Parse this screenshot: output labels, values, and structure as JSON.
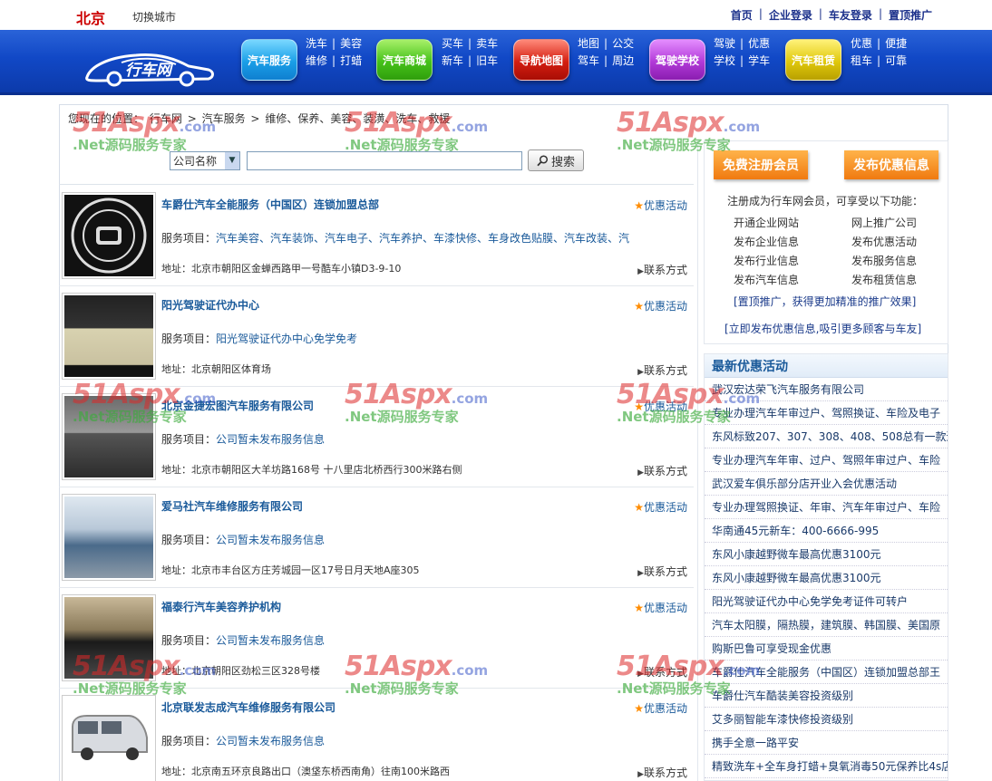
{
  "header": {
    "city": "北京",
    "switch_city": "切换城市",
    "links": [
      "首页",
      "企业登录",
      "车友登录",
      "置顶推广"
    ]
  },
  "nav": {
    "logo_text": "行车网",
    "groups": [
      {
        "button": "汽车服务",
        "links": [
          [
            "洗车",
            "美容"
          ],
          [
            "维修",
            "打蜡"
          ]
        ]
      },
      {
        "button": "汽车商城",
        "links": [
          [
            "买车",
            "卖车"
          ],
          [
            "新车",
            "旧车"
          ]
        ]
      },
      {
        "button": "导航地图",
        "links": [
          [
            "地图",
            "公交"
          ],
          [
            "驾车",
            "周边"
          ]
        ]
      },
      {
        "button": "驾驶学校",
        "links": [
          [
            "驾驶",
            "优惠"
          ],
          [
            "学校",
            "学车"
          ]
        ]
      },
      {
        "button": "汽车租赁",
        "links": [
          [
            "优惠",
            "便捷"
          ],
          [
            "租车",
            "可靠"
          ]
        ]
      }
    ]
  },
  "breadcrumb": {
    "prefix": "您现在的位置：",
    "items": [
      "行车网",
      "汽车服务",
      "维修、保养、美容、装潢、洗车、救援"
    ],
    "sep": ">"
  },
  "search": {
    "select_value": "公司名称",
    "button": "搜索"
  },
  "listing_labels": {
    "service": "服务项目：",
    "address": "地址：",
    "promo": "优惠活动",
    "contact": "联系方式"
  },
  "listings": [
    {
      "name": "车爵仕汽车全能服务（中国区）连锁加盟总部",
      "service": "汽车美容、汽车装饰、汽车电子、汽车养护、车漆快修、车身改色贴膜、汽车改装、汽",
      "address": "北京市朝阳区金蝉西路甲一号酷车小镇D3-9-10"
    },
    {
      "name": "阳光驾驶证代办中心",
      "service": "阳光驾驶证代办中心免学免考",
      "address": "北京朝阳区体育场"
    },
    {
      "name": "北京金捷宏图汽车服务有限公司",
      "service": "公司暂未发布服务信息",
      "address": "北京市朝阳区大羊坊路168号 十八里店北桥西行300米路右侧"
    },
    {
      "name": "爱马社汽车维修服务有限公司",
      "service": "公司暂未发布服务信息",
      "address": "北京市丰台区方庄芳城园一区17号日月天地A座305"
    },
    {
      "name": "福泰行汽车美容养护机构",
      "service": "公司暂未发布服务信息",
      "address": "北京朝阳区劲松三区328号楼"
    },
    {
      "name": "北京联发志成汽车维修服务有限公司",
      "service": "公司暂未发布服务信息",
      "address": "北京南五环京良路出口（澳垡东桥西南角）往南100米路西"
    }
  ],
  "right": {
    "register_button": "免费注册会员",
    "publish_button": "发布优惠信息",
    "intro": "注册成为行车网会员，可享受以下功能：",
    "features": [
      "开通企业网站",
      "网上推广公司",
      "发布企业信息",
      "发布优惠活动",
      "发布行业信息",
      "发布服务信息",
      "发布汽车信息",
      "发布租赁信息"
    ],
    "link1": "[置顶推广，获得更加精准的推广效果]",
    "link2": "[立即发布优惠信息,吸引更多顾客与车友]",
    "promo_title": "最新优惠活动",
    "promos": [
      "武汉宏达荣飞汽车服务有限公司",
      "专业办理汽车年审过户、驾照换证、车险及电子",
      "东风标致207、307、308、408、508总有一款适合",
      "专业办理汽车年审、过户、驾照年审过户、车险",
      "武汉爱车俱乐部分店开业入会优惠活动",
      "专业办理驾照换证、年审、汽车年审过户、车险",
      "华南通45元新车：400-6666-995",
      "东风小康越野微车最高优惠3100元",
      "东风小康越野微车最高优惠3100元",
      "阳光驾驶证代办中心免学免考证件可转户",
      "汽车太阳膜，隔热膜，建筑膜、韩国膜、美国原",
      "购斯巴鲁可享受现金优惠",
      "车爵仕汽车全能服务（中国区）连锁加盟总部王",
      "车爵仕汽车酷装美容投资级别",
      "艾多丽智能车漆快修投资级别",
      "携手全意一路平安",
      "精致洗车+全车身打蜡+臭氧消毒50元保养比4s店"
    ]
  },
  "watermark": {
    "big": "51Aspx",
    "com": ".com",
    "sub": ".Net源码服务专家"
  }
}
